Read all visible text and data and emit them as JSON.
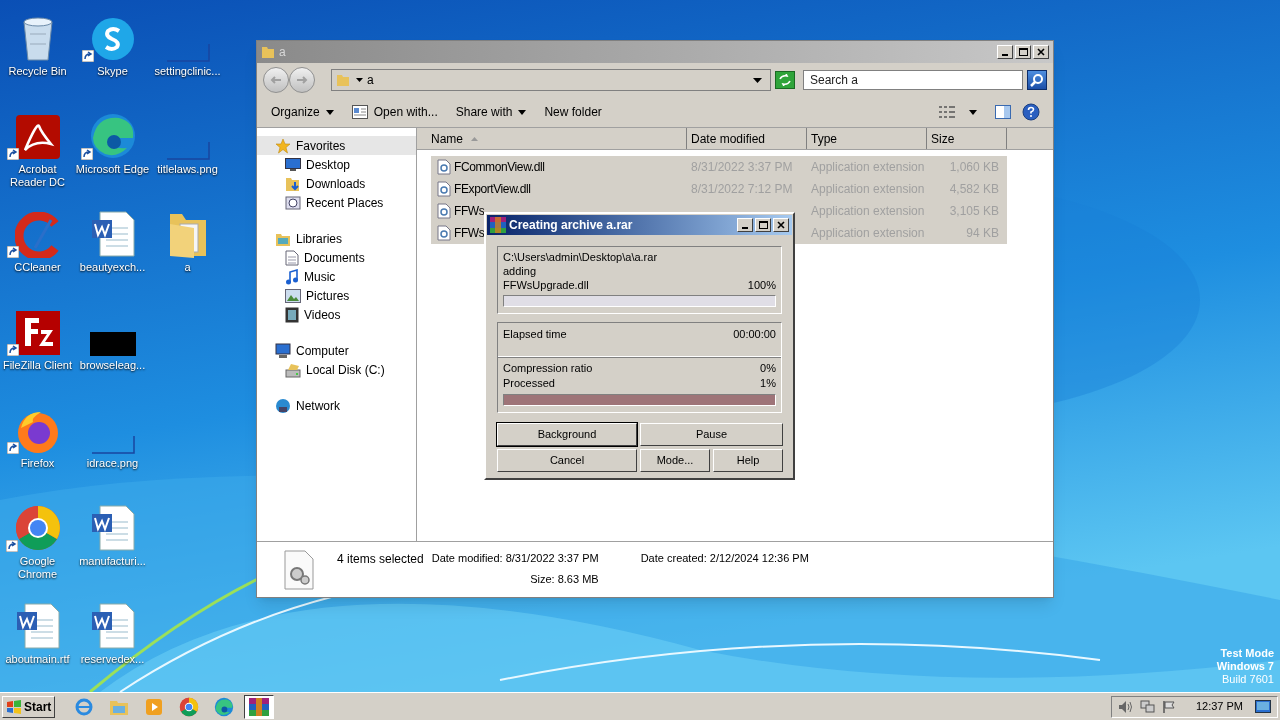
{
  "desktop_icons": [
    {
      "label": "Recycle Bin",
      "kind": "recycle",
      "shortcut": false
    },
    {
      "label": "Acrobat Reader DC",
      "kind": "acrobat",
      "shortcut": true
    },
    {
      "label": "CCleaner",
      "kind": "ccleaner",
      "shortcut": true
    },
    {
      "label": "FileZilla Client",
      "kind": "filezilla",
      "shortcut": true
    },
    {
      "label": "Firefox",
      "kind": "firefox",
      "shortcut": true
    },
    {
      "label": "Google Chrome",
      "kind": "chrome",
      "shortcut": true
    },
    {
      "label": "aboutmain.rtf",
      "kind": "word",
      "shortcut": false
    },
    {
      "label": "Skype",
      "kind": "skype",
      "shortcut": true
    },
    {
      "label": "Microsoft Edge",
      "kind": "edge",
      "shortcut": true
    },
    {
      "label": "beautyexch...",
      "kind": "word",
      "shortcut": false
    },
    {
      "label": "browseleag...",
      "kind": "black",
      "shortcut": false
    },
    {
      "label": "idrace.png",
      "kind": "blank",
      "shortcut": false
    },
    {
      "label": "manufacturi...",
      "kind": "word",
      "shortcut": false
    },
    {
      "label": "reservedex...",
      "kind": "word",
      "shortcut": false
    },
    {
      "label": "settingclinic...",
      "kind": "blank",
      "shortcut": false
    },
    {
      "label": "titlelaws.png",
      "kind": "blank",
      "shortcut": false
    },
    {
      "label": "a",
      "kind": "folder",
      "shortcut": false
    }
  ],
  "explorer": {
    "title": "a",
    "address": "a",
    "search": {
      "placeholder": "Search a"
    },
    "toolbar": [
      {
        "label": "Organize",
        "kind": "menu"
      },
      {
        "label": "Open with...",
        "kind": "open"
      },
      {
        "label": "Share with",
        "kind": "menu"
      },
      {
        "label": "New folder",
        "kind": "plain"
      }
    ],
    "nav": [
      {
        "label": "Favorites",
        "kind": "star",
        "selected": true,
        "children": [
          {
            "label": "Desktop",
            "kind": "desktop",
            "selected": false
          },
          {
            "label": "Downloads",
            "kind": "downloads",
            "selected": false
          },
          {
            "label": "Recent Places",
            "kind": "recent",
            "selected": false
          }
        ]
      },
      {
        "label": "Libraries",
        "kind": "libraries",
        "selected": false,
        "children": [
          {
            "label": "Documents",
            "kind": "documents",
            "selected": false
          },
          {
            "label": "Music",
            "kind": "music",
            "selected": false
          },
          {
            "label": "Pictures",
            "kind": "pictures",
            "selected": false
          },
          {
            "label": "Videos",
            "kind": "videos",
            "selected": false
          }
        ]
      },
      {
        "label": "Computer",
        "kind": "computer",
        "selected": false,
        "children": [
          {
            "label": "Local Disk (C:)",
            "kind": "disk",
            "selected": false
          }
        ]
      },
      {
        "label": "Network",
        "kind": "network",
        "selected": false
      }
    ],
    "columns": [
      "Name",
      "Date modified",
      "Type",
      "Size"
    ],
    "rows": [
      {
        "name": "FCommonView.dll",
        "date": "8/31/2022 3:37 PM",
        "type": "Application extension",
        "size": "1,060 KB",
        "selected": true
      },
      {
        "name": "FExportView.dll",
        "date": "8/31/2022 7:12 PM",
        "type": "Application extension",
        "size": "4,582 KB",
        "selected": true
      },
      {
        "name": "FFWs",
        "type": "Application extension",
        "size": "3,105 KB",
        "selected": true
      },
      {
        "name": "FFWs",
        "type": "Application extension",
        "size": "94 KB",
        "selected": true
      }
    ],
    "details": {
      "count": "4 items selected",
      "modified": "Date modified: 8/31/2022 3:37 PM",
      "size": "Size: 8.63 MB",
      "created": "Date created: 2/12/2024 12:36 PM"
    }
  },
  "dialog": {
    "title": "Creating archive a.rar",
    "path": "C:\\Users\\admin\\Desktop\\a\\a.rar",
    "action": "adding",
    "file": "FFWsUpgrade.dll",
    "file_percent": "100%",
    "file_progress": {
      "level": 1
    },
    "elapsed_label": "Elapsed time",
    "elapsed": "00:00:00",
    "ratio_label": "Compression ratio",
    "ratio": "0%",
    "processed_label": "Processed",
    "processed": "1%",
    "total_progress": {
      "level": 1
    },
    "buttons": [
      {
        "label": "Background",
        "default": true
      },
      {
        "label": "Pause",
        "default": false
      },
      {
        "label": "Cancel",
        "default": false
      },
      {
        "label": "Mode...",
        "default": false
      },
      {
        "label": "Help",
        "default": false
      }
    ]
  },
  "taskbar": {
    "start": "Start",
    "apps": [
      {
        "kind": "ie",
        "active": false
      },
      {
        "kind": "explorer",
        "active": false
      },
      {
        "kind": "media",
        "active": false
      },
      {
        "kind": "chrome",
        "active": false
      },
      {
        "kind": "edge",
        "active": false
      },
      {
        "kind": "winrar",
        "active": true
      }
    ],
    "clock": "12:37 PM"
  },
  "watermark_text": [
    "Test Mode",
    "Windows 7",
    "Build 7601"
  ]
}
